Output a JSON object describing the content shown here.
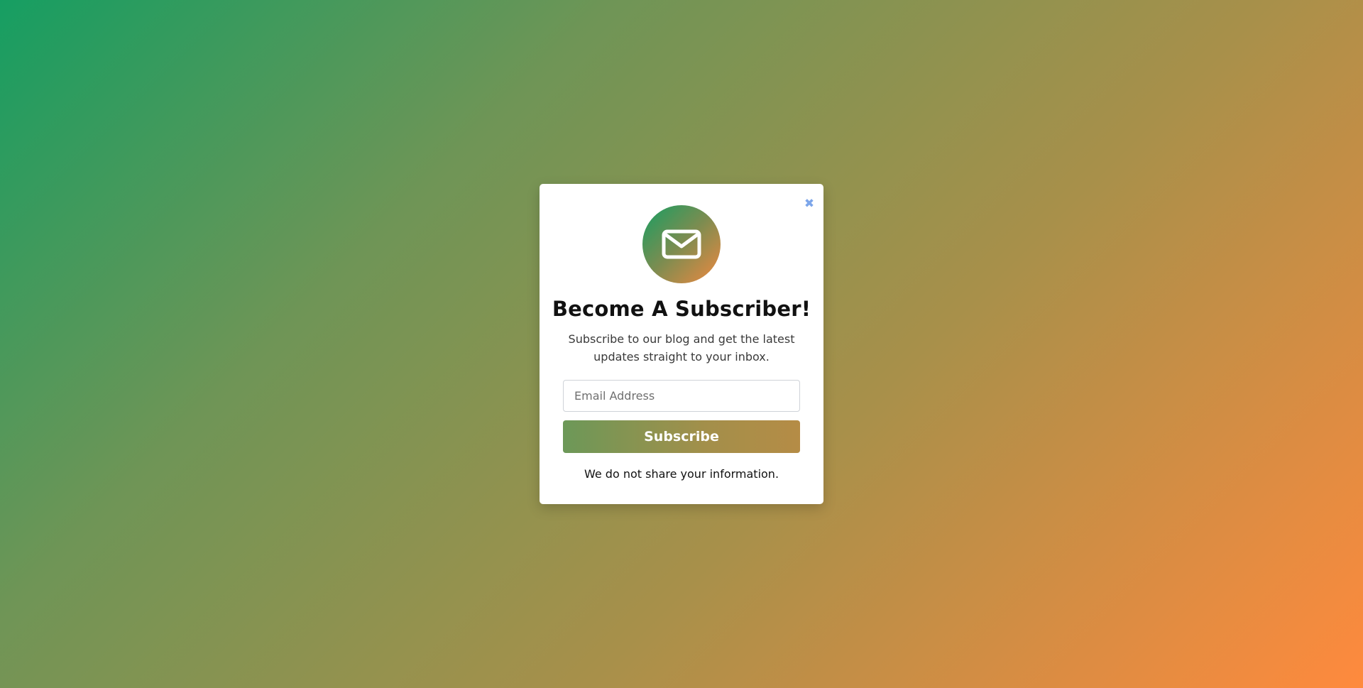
{
  "page": {
    "background_gradient": [
      "#169e62",
      "#ff8a3d"
    ]
  },
  "modal": {
    "close_symbol": "✖",
    "icon": "envelope-icon",
    "icon_gradient": [
      "#169e62",
      "#ef8940"
    ],
    "title": "Become A Subscriber!",
    "subtitle": "Subscribe to our blog and get the latest updates straight to your inbox.",
    "email_placeholder": "Email Address",
    "email_value": "",
    "subscribe_label": "Subscribe",
    "note": "We do not share your information.",
    "close_color": "#7da6ea"
  }
}
